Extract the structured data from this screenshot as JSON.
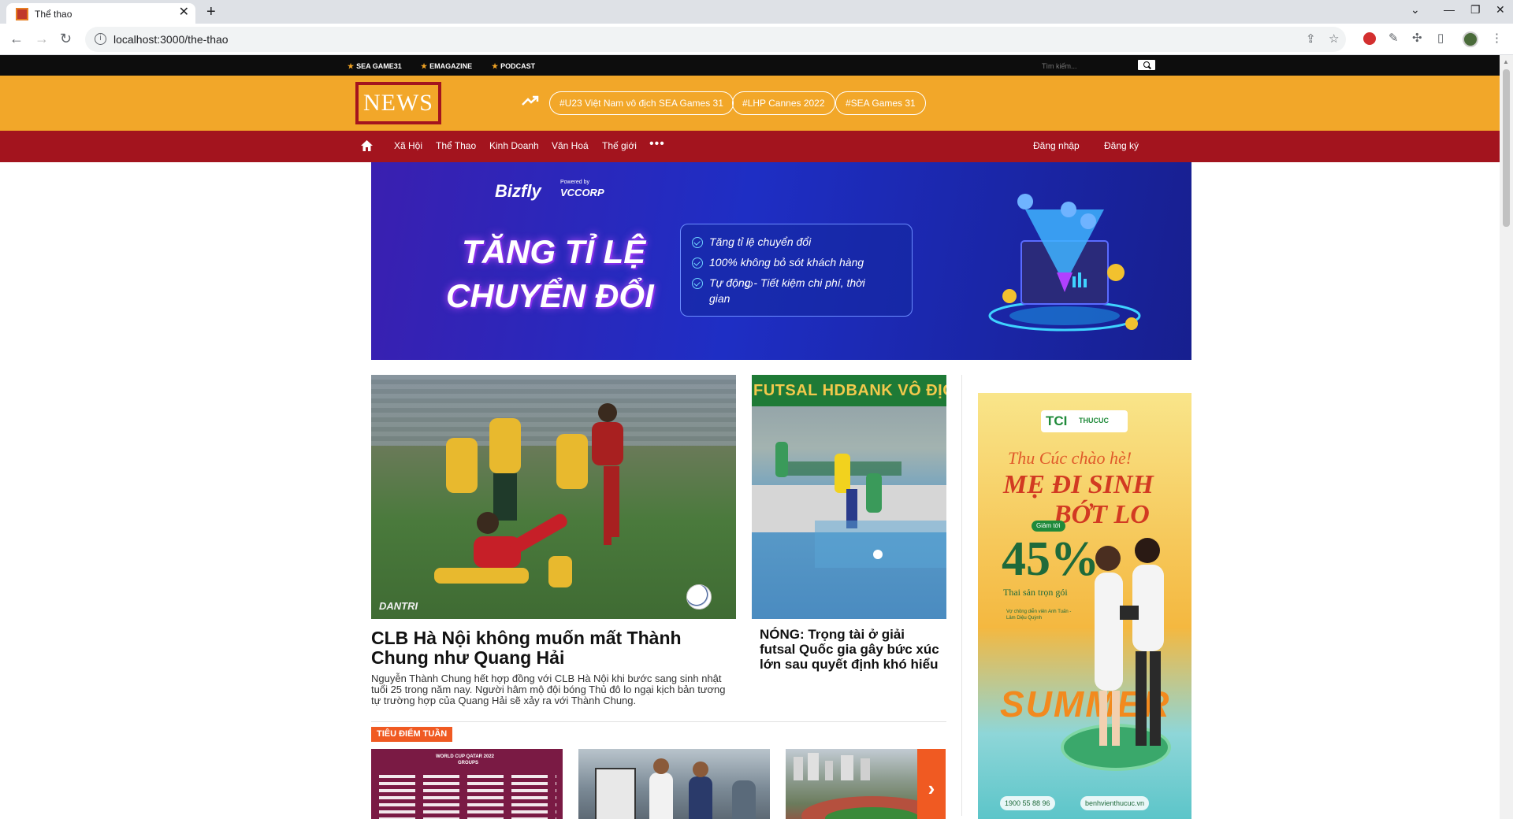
{
  "browser": {
    "tab_title": "Thể thao",
    "url": "localhost:3000/the-thao",
    "new_tab_symbol": "+",
    "tab_close_symbol": "✕"
  },
  "topbar": {
    "links": [
      "SEA GAME31",
      "EMAGAZINE",
      "PODCAST"
    ],
    "search_placeholder": "Tìm kiếm..."
  },
  "header": {
    "logo": "NEWS",
    "trending": [
      "#U23 Việt Nam vô địch SEA Games 31",
      "#LHP Cannes 2022",
      "#SEA Games 31"
    ]
  },
  "nav": {
    "items": [
      "Xã Hội",
      "Thể Thao",
      "Kinh Doanh",
      "Văn Hoá",
      "Thế giới"
    ],
    "more_symbol": "•••",
    "login": "Đăng nhập",
    "register": "Đăng ký"
  },
  "banner_ad": {
    "brand": "Bizfly",
    "powered_by": "Powered by",
    "partner": "VCCORP",
    "headline_line1": "TĂNG TỈ LỆ",
    "headline_line2": "CHUYỂN ĐỔI",
    "bullets": [
      "Tăng tỉ lệ chuyển đổi",
      "100% không bỏ sót khách hàng",
      "Tự động - Tiết kiệm chi phí, thời",
      "gian"
    ]
  },
  "articles": {
    "main": {
      "image_watermark": "DANTRI",
      "title": "CLB Hà Nội không muốn mất Thành Chung như Quang Hải",
      "description": "Nguyễn Thành Chung hết hợp đồng với CLB Hà Nội khi bước sang sinh nhật tuổi 25 trong năm nay. Người hâm mộ đội bóng Thủ đô lo ngại kịch bản tương tự trường hợp của Quang Hải sẽ xảy ra với Thành Chung."
    },
    "side": {
      "image_caption": "FUTSAL HDBANK VÔ ĐỊCH QUỐC",
      "title": "NÓNG: Trọng tài ở giải futsal Quốc gia gây bức xúc lớn sau quyết định khó hiểu"
    }
  },
  "section": {
    "label": "TIÊU ĐIỂM TUẦN",
    "thumb_wc_title": "WORLD CUP QATAR 2022",
    "thumb_wc_sub": "GROUPS",
    "next_symbol": "›"
  },
  "side_ad": {
    "brand": "TCI",
    "brand_sub": "THUCUC",
    "script_line": "Thu Cúc chào hè!",
    "headline1": "MẸ ĐI SINH",
    "headline2": "BỚT LO",
    "badge": "Giảm tới",
    "percent": "45%",
    "package": "Thai sản trọn gói",
    "subtext": "Vợ chồng diễn viên Anh Tuấn - Lâm Diệu Quỳnh",
    "summer": "SUMMER",
    "phone": "1900 55 88 96",
    "website": "benhvienthucuc.vn"
  },
  "colors": {
    "orange": "#f2a729",
    "red": "#a3141e",
    "accent": "#f05a22",
    "black": "#0d0d0d"
  }
}
